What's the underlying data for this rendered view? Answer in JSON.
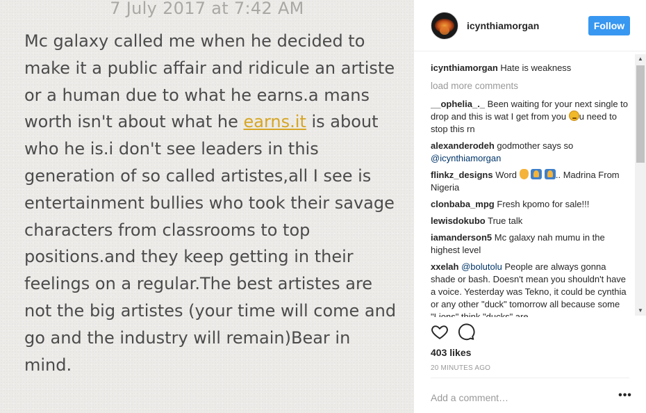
{
  "photo": {
    "date": "7 July 2017 at 7:42 AM",
    "text_before_link": "Mc galaxy called me when he decided to make it a public affair and ridicule an artiste or a human due to what he earns.a mans worth isn't about what he ",
    "link_text": "earns.it",
    "text_after_link": " is about who he is.i don't see leaders in this generation of so called artistes,all I see is entertainment bullies who took their savage characters from classrooms to top positions.and they keep getting in their feelings on a regular.The best artistes are not the big artistes (your time will come and go and the industry will remain)Bear in mind."
  },
  "header": {
    "username": "icynthiamorgan",
    "follow_label": "Follow"
  },
  "caption": {
    "username": "icynthiamorgan",
    "text": "Hate is weakness"
  },
  "load_more": "load more comments",
  "comments": [
    {
      "username": "__ophelia_._",
      "text_a": "Been waiting for your next single to drop and this is wat I get from you ",
      "text_b": "u need to stop this rn"
    },
    {
      "username": "alexanderodeh",
      "text_a": "godmother says so ",
      "mention": "@icynthiamorgan"
    },
    {
      "username": "flinkz_designs",
      "text_a": "Word ",
      "text_b": ".. Madrina From Nigeria"
    },
    {
      "username": "clonbaba_mpg",
      "text_a": "Fresh kpomo for sale!!!"
    },
    {
      "username": "lewisdokubo",
      "text_a": "True talk"
    },
    {
      "username": "iamanderson5",
      "text_a": "Mc galaxy nah mumu in the highest level"
    },
    {
      "username": "xxelah",
      "mention": "@bolutolu",
      "text_a": " People are always gonna shade or bash. Doesn't mean you shouldn't have a voice. Yesterday was Tekno, it could be cynthia or any other \"duck\" tomorrow all because some \"Lions\" think \"ducks\" are"
    }
  ],
  "likes": "403 likes",
  "time_ago": "20 MINUTES AGO",
  "add_comment_placeholder": "Add a comment…",
  "more_label": "•••",
  "icons": {
    "like": "heart-outline-icon",
    "comment": "speech-bubble-icon"
  },
  "colors": {
    "follow": "#3897f0",
    "link": "#d6a524",
    "mention": "#003569"
  }
}
